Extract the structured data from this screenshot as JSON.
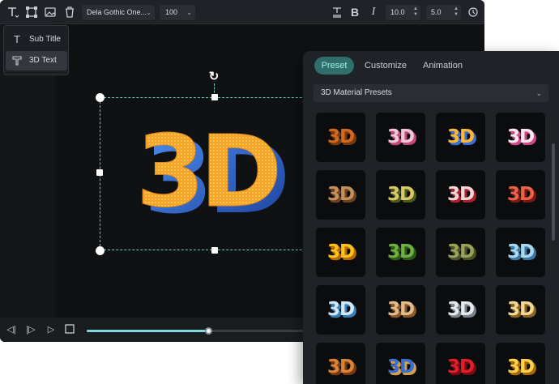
{
  "toolbar": {
    "font_family": "Dela Gothic One...",
    "font_size": "100",
    "line_spacing": "10.0",
    "letter_spacing": "5.0",
    "icons": [
      "text-type-icon",
      "transform-icon",
      "image-icon",
      "delete-icon",
      "text-align-icon",
      "bold-icon",
      "italic-icon",
      "reset-icon"
    ]
  },
  "text_menu": {
    "items": [
      {
        "label": "Sub Title",
        "icon": "text-icon"
      },
      {
        "label": "3D Text",
        "icon": "3d-text-icon"
      }
    ],
    "selected": "3D Text"
  },
  "canvas": {
    "text": "3D",
    "accent": "#5fd3b4"
  },
  "playback": {
    "progress": 0.54,
    "icons": [
      "previous-frame-icon",
      "next-frame-icon",
      "play-icon",
      "stop-icon"
    ]
  },
  "panel": {
    "tabs": [
      "Preset",
      "Customize",
      "Animation"
    ],
    "active_tab": "Preset",
    "preset_category": "3D Material Presets",
    "presets": [
      {
        "label": "3D",
        "color": "#d2691e",
        "shadow": "#7a3a10"
      },
      {
        "label": "3D",
        "color": "#f2c6d6",
        "shadow": "#c24a7a"
      },
      {
        "label": "3D",
        "color": "#ffb733",
        "shadow": "#3b6fd1"
      },
      {
        "label": "3D",
        "color": "#fbe7f0",
        "shadow": "#d04a8a"
      },
      {
        "label": "3D",
        "color": "#c7905a",
        "shadow": "#6b4424"
      },
      {
        "label": "3D",
        "color": "#d9c86a",
        "shadow": "#4f5a1e"
      },
      {
        "label": "3D",
        "color": "#f0d8d8",
        "shadow": "#b01e2e"
      },
      {
        "label": "3D",
        "color": "#e8634a",
        "shadow": "#7a1a12"
      },
      {
        "label": "3D",
        "color": "#ffc21a",
        "shadow": "#b86a00"
      },
      {
        "label": "3D",
        "color": "#6fb043",
        "shadow": "#2d5a16"
      },
      {
        "label": "3D",
        "color": "#9aa25a",
        "shadow": "#4b5226"
      },
      {
        "label": "3D",
        "color": "#a8d8f0",
        "shadow": "#3a78a6"
      },
      {
        "label": "3D",
        "color": "#cfe9f6",
        "shadow": "#3b7fb8"
      },
      {
        "label": "3D",
        "color": "#e3bc8a",
        "shadow": "#8a5a2a"
      },
      {
        "label": "3D",
        "color": "#e5e9ec",
        "shadow": "#7a8590"
      },
      {
        "label": "3D",
        "color": "#f2d898",
        "shadow": "#8a6420"
      },
      {
        "label": "3D",
        "color": "#d8843a",
        "shadow": "#7a3a10"
      },
      {
        "label": "3D",
        "color": "#3a6fd0",
        "shadow": "#d4a04a"
      },
      {
        "label": "3D",
        "color": "#e01e2e",
        "shadow": "#7a0a14"
      },
      {
        "label": "3D",
        "color": "#ffd24a",
        "shadow": "#a86a00"
      }
    ]
  }
}
